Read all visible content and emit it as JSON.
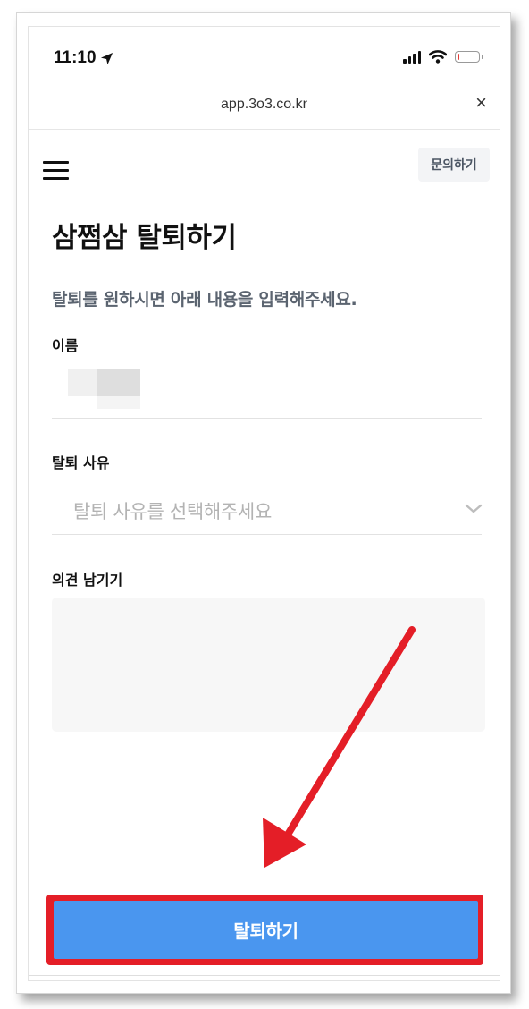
{
  "status_bar": {
    "time": "11:10",
    "battery_level_percent": 10
  },
  "browser": {
    "url": "app.3o3.co.kr",
    "close_glyph": "×"
  },
  "header": {
    "inquiry_label": "문의하기",
    "menu_icon": "hamburger-menu-icon"
  },
  "page": {
    "title": "삼쩜삼 탈퇴하기",
    "subtitle": "탈퇴를 원하시면 아래 내용을 입력해주세요."
  },
  "form": {
    "name_label": "이름",
    "reason_label": "탈퇴 사유",
    "reason_placeholder": "탈퇴 사유를 선택해주세요",
    "comment_label": "의견 남기기",
    "comment_value": ""
  },
  "actions": {
    "withdraw_label": "탈퇴하기"
  },
  "colors": {
    "primary_button": "#4a96ef",
    "annotation_red": "#e41e27",
    "subtitle_gray": "#5b6470",
    "placeholder_gray": "#b3b3b3"
  }
}
